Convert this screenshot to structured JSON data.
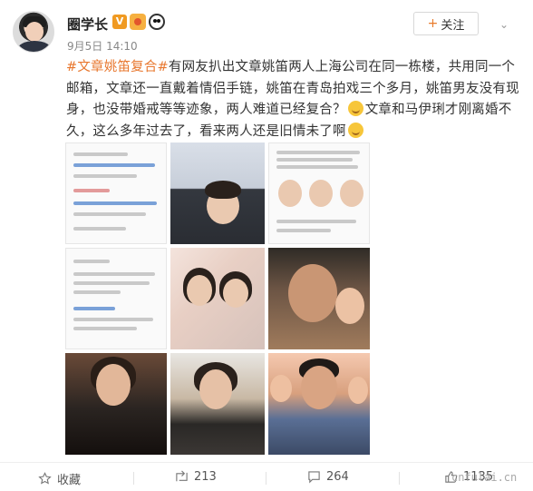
{
  "header": {
    "username": "圈学长",
    "v_badge": "V",
    "post_time": "9月5日 14:10",
    "follow_label": "关注",
    "follow_plus": "+"
  },
  "post": {
    "hashtag": "#文章姚笛复合#",
    "text_1": "有网友扒出文章姚笛两人上海公司在同一栋楼，共用同一个邮箱，文章还一直戴着情侣手链，姚笛在青岛拍戏三个多月，姚笛男友没有现身，也没带婚戒等等迹象，两人难道已经复合？",
    "text_2": "文章和马伊琍才刚离婚不久，这么多年过去了，看来两人还是旧情未了啊",
    "emoji_1": "thinking-face",
    "emoji_2": "thinking-face"
  },
  "images": {
    "count": 9,
    "subjects": [
      "screenshot-list",
      "photo-collage",
      "article-screenshot",
      "comment-screenshot",
      "selfie-pair",
      "father-daughter",
      "woman-portrait",
      "woman-portrait-2",
      "man-group"
    ]
  },
  "footer": {
    "favorite_label": "收藏",
    "repost_count": "213",
    "comment_count": "264",
    "like_count": "1135",
    "watermark": "cnfulai.cn"
  },
  "colors": {
    "hashtag": "#e8772e",
    "follow_plus": "#e87b2c",
    "meta": "#888888"
  }
}
